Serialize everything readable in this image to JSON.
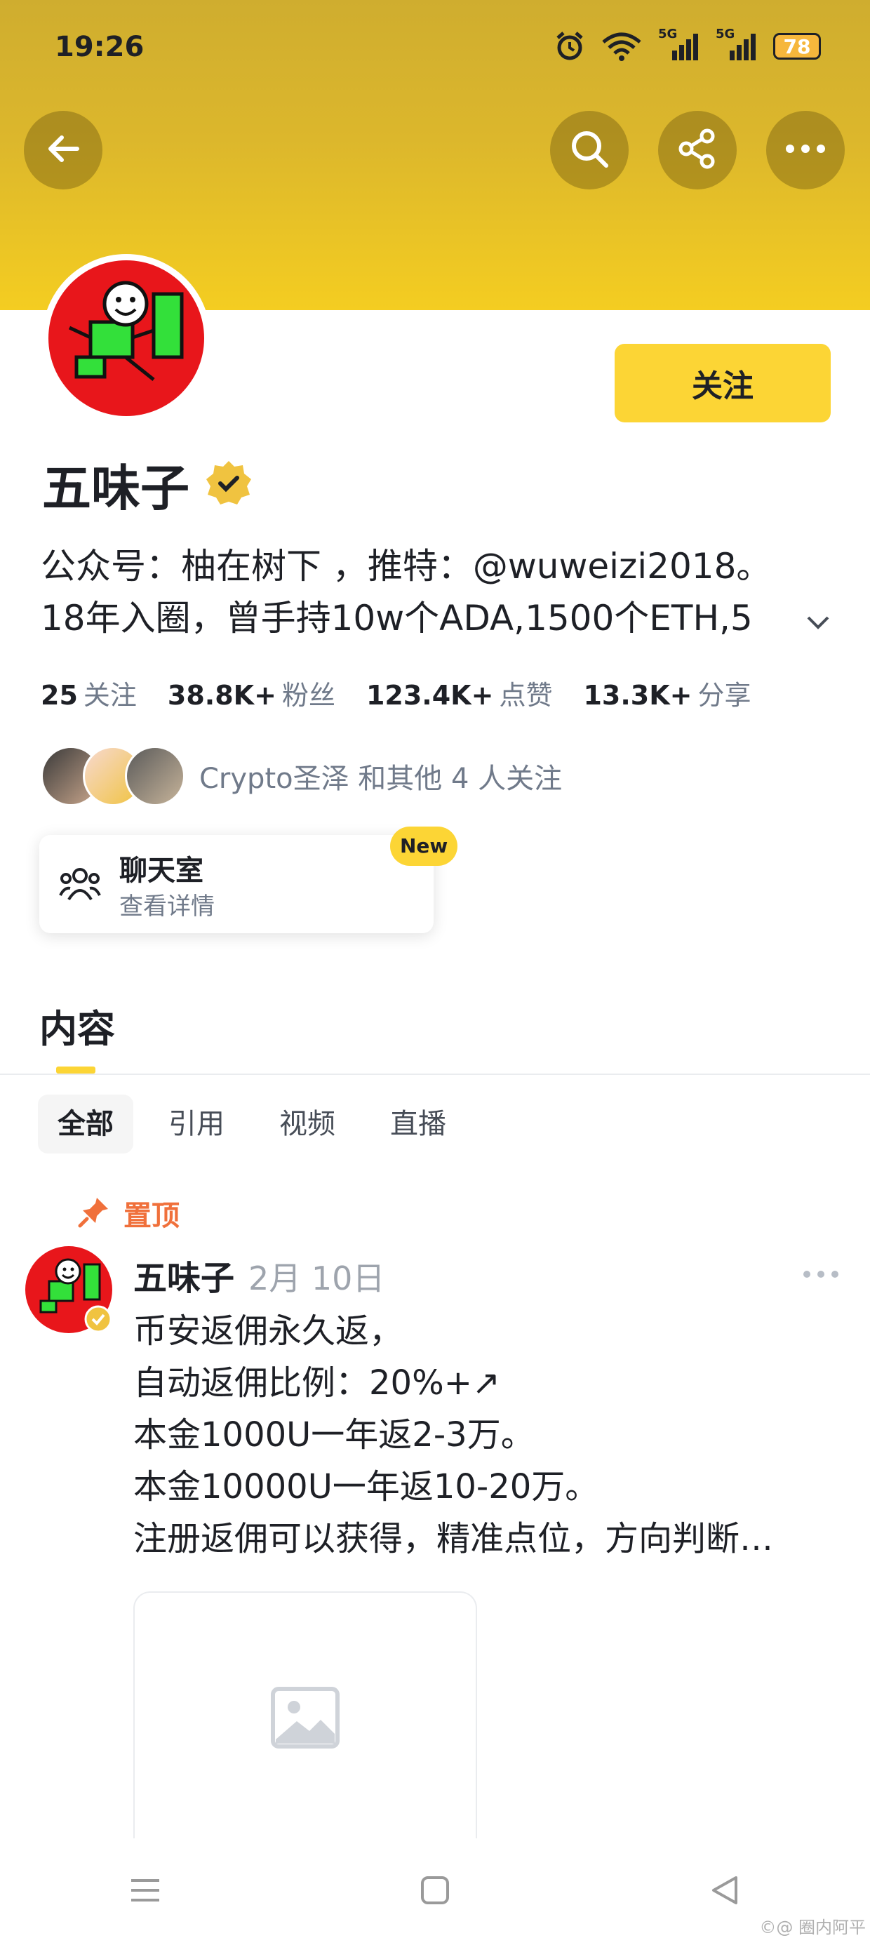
{
  "status_bar": {
    "time": "19:26",
    "battery": "78",
    "network_1": "5G",
    "network_2": "5G"
  },
  "header": {
    "back_icon": "arrow-left-icon",
    "search_icon": "search-icon",
    "share_icon": "share-icon",
    "more_icon": "more-horizontal-icon",
    "colors": {
      "gradient_top": "#cfad2f",
      "gradient_bottom": "#f4cd21"
    }
  },
  "profile": {
    "name": "五味子",
    "verified_icon": "verified-badge-icon",
    "follow_button": "关注",
    "bio_line1": "公众号：柚在树下 ，推特：@wuweizi2018。",
    "bio_line2": "18年入圈，曾手持10w个ADA,1500个ETH,5",
    "stats": [
      {
        "value": "25",
        "label": "关注"
      },
      {
        "value": "38.8K+",
        "label": "粉丝"
      },
      {
        "value": "123.4K+",
        "label": "点赞"
      },
      {
        "value": "13.3K+",
        "label": "分享"
      }
    ],
    "followed_by": "Crypto圣泽 和其他 4 人关注"
  },
  "chat_room": {
    "title": "聊天室",
    "subtitle": "查看详情",
    "badge": "New"
  },
  "content": {
    "tab": "内容",
    "filters": [
      "全部",
      "引用",
      "视频",
      "直播"
    ]
  },
  "post": {
    "pinned": "置顶",
    "author": "五味子",
    "date": "2月 10日",
    "lines": [
      "币安返佣永久返，",
      "自动返佣比例：20%+↗",
      "本金1000U一年返2-3万。",
      "本金10000U一年返10-20万。",
      "注册返佣可以获得，精准点位，方向判断…"
    ]
  },
  "watermark": "©@ 圈内阿平",
  "colors": {
    "accent": "#fcd535",
    "pinned": "#f0703b",
    "muted": "#707a8a"
  }
}
